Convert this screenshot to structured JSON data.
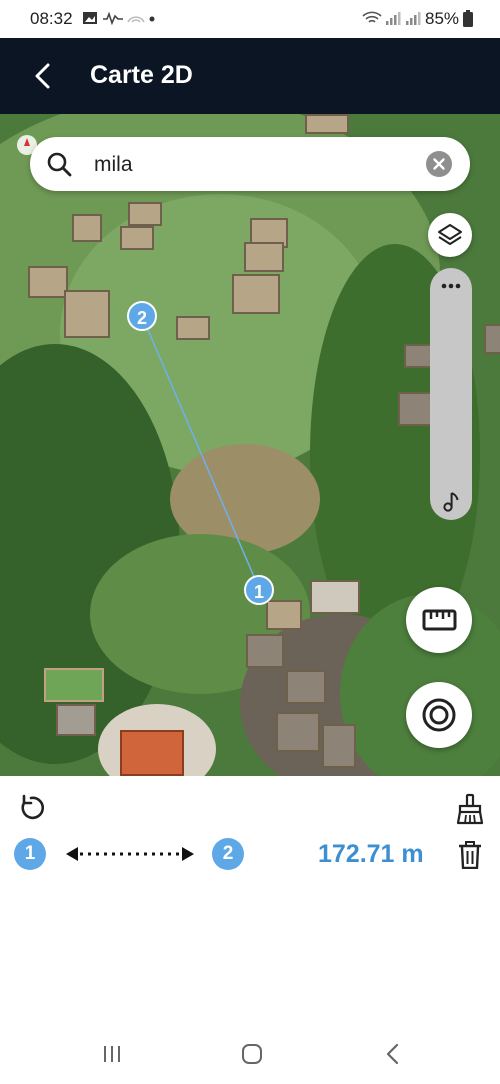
{
  "status_bar": {
    "time": "08:32",
    "battery": "85%"
  },
  "header": {
    "title": "Carte 2D",
    "back_icon": "chevron-left-icon"
  },
  "search": {
    "value": "mila",
    "icon": "search-icon",
    "clear_icon": "close-icon"
  },
  "map": {
    "controls": {
      "layers_icon": "layers-icon",
      "slider_top_icon": "more-dots-icon",
      "slider_bottom_icon": "music-note-icon",
      "ruler_icon": "ruler-icon",
      "locate_icon": "target-icon"
    },
    "markers": [
      {
        "label": "1"
      },
      {
        "label": "2"
      }
    ]
  },
  "measure_panel": {
    "undo_icon": "undo-icon",
    "clear_icon": "broom-icon",
    "from_point": "1",
    "to_point": "2",
    "distance": "172.71 m",
    "delete_icon": "trash-icon"
  },
  "nav_bar": {
    "icons": [
      "recent-apps-icon",
      "home-icon",
      "back-icon"
    ]
  },
  "colors": {
    "header_bg": "#0b1524",
    "accent": "#5fa8e8",
    "distance_text": "#3d8fd1"
  }
}
